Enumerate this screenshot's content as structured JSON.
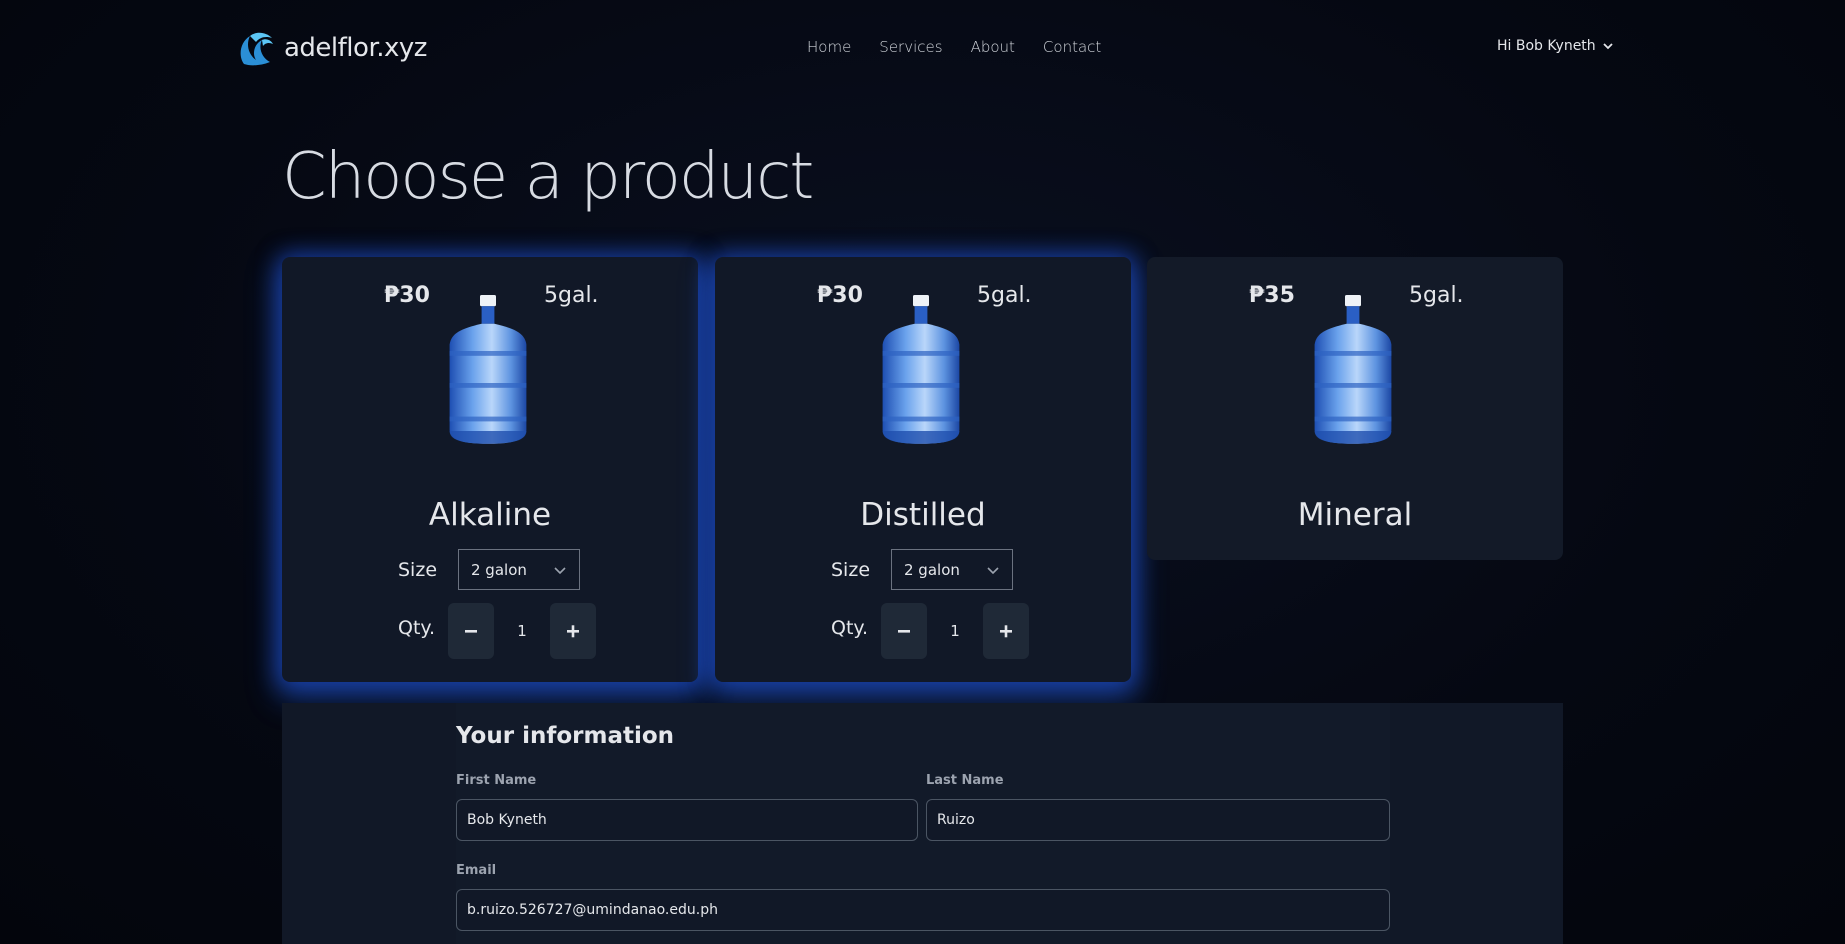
{
  "brand": {
    "name": "adelflor.xyz"
  },
  "nav": {
    "links": [
      "Home",
      "Services",
      "About",
      "Contact"
    ],
    "user_greeting": "Hi Bob Kyneth"
  },
  "page": {
    "title": "Choose a product"
  },
  "products": [
    {
      "name": "Alkaline",
      "price": "₱30",
      "volume": "5gal.",
      "size_label": "Size",
      "size_value": "2 galon",
      "qty_label": "Qty.",
      "qty": "1",
      "selected": true
    },
    {
      "name": "Distilled",
      "price": "₱30",
      "volume": "5gal.",
      "size_label": "Size",
      "size_value": "2 galon",
      "qty_label": "Qty.",
      "qty": "1",
      "selected": true
    },
    {
      "name": "Mineral",
      "price": "₱35",
      "volume": "5gal.",
      "selected": false
    }
  ],
  "info": {
    "title": "Your information",
    "first_name_label": "First Name",
    "first_name": "Bob Kyneth",
    "last_name_label": "Last Name",
    "last_name": "Ruizo",
    "email_label": "Email",
    "email": "b.ruizo.526727@umindanao.edu.ph"
  },
  "icons": {
    "logo": "wave-logo-icon",
    "user_menu": "chevron-down-icon",
    "select": "chevron-down-icon",
    "minus": "minus-icon",
    "plus": "plus-icon",
    "product_image": "water-jug-icon"
  },
  "colors": {
    "accent_glow": "#2563eb",
    "card": "#111827",
    "background": "#050812",
    "logo": "#38bdf8"
  }
}
